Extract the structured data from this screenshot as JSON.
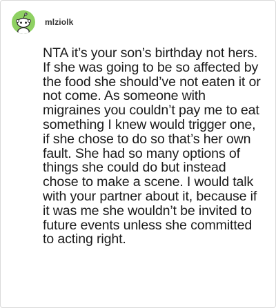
{
  "post": {
    "author": "mlziolk",
    "avatar_icon": "reddit-snoo-avatar-icon",
    "avatar_color": "#8fd163",
    "comment_text": "NTA it’s your son’s birthday not hers. If she was going to be so affected by the food she should’ve not eaten it or not come. As someone with migraines you couldn’t pay me to eat something I knew would trigger one, if she chose to do so that’s her own fault. She had so many options of things she could do but instead chose to make a scene. I would talk with your partner about it, because if it was me she wouldn’t be invited to future events unless she committed to acting right."
  }
}
